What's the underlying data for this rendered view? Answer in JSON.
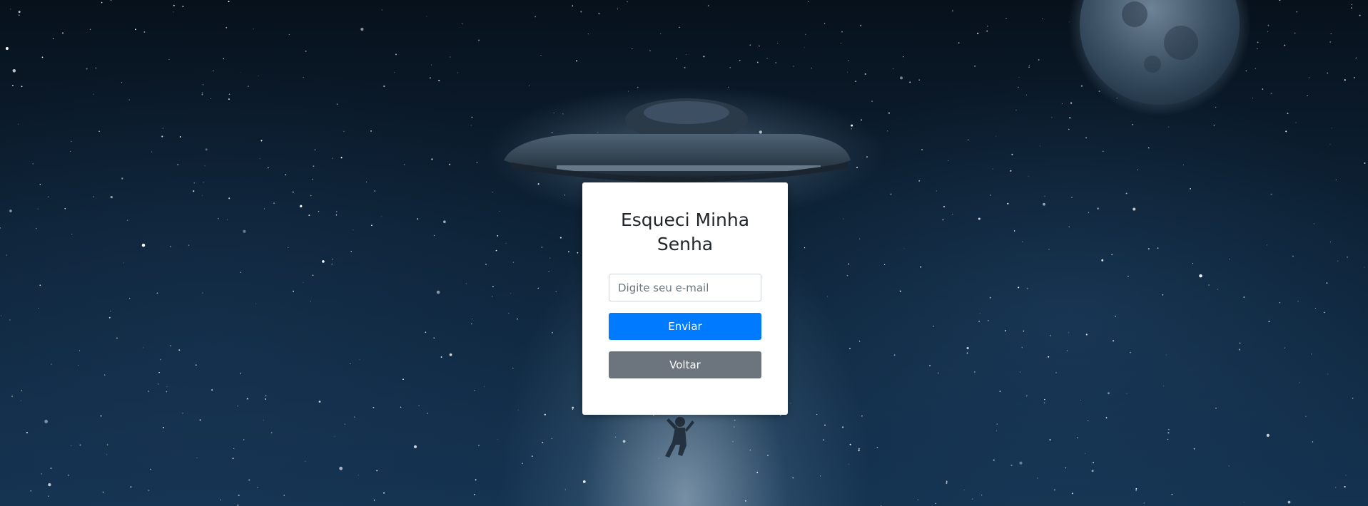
{
  "page": {
    "title": "Esqueci Minha Senha"
  },
  "form": {
    "email_placeholder": "Digite seu e-mail",
    "email_value": "",
    "submit_label": "Enviar",
    "back_label": "Voltar"
  },
  "background": {
    "description_icons": [
      "starfield",
      "moon",
      "ufo",
      "abducted-person"
    ]
  },
  "colors": {
    "primary": "#007bff",
    "secondary": "#6c757d",
    "card": "#ffffff"
  }
}
